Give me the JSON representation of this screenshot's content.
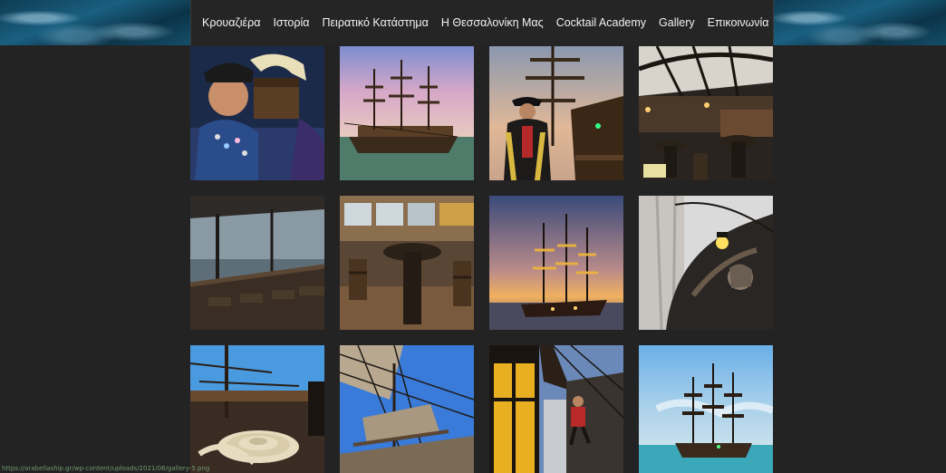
{
  "nav": {
    "items": [
      "Κρουαζιέρα",
      "Ιστορία",
      "Πειρατικό Κατάστημα",
      "Η Θεσσαλονίκη Μας",
      "Cocktail Academy",
      "Gallery",
      "Επικοινωνία"
    ],
    "flags": [
      "greek-flag-icon",
      "english-flag-icon"
    ]
  },
  "gallery": {
    "tiles": [
      {
        "name": "gallery-photo-pirate-with-chest"
      },
      {
        "name": "gallery-photo-ship-sunset-sea"
      },
      {
        "name": "gallery-photo-captain-on-deck"
      },
      {
        "name": "gallery-photo-deck-bar"
      },
      {
        "name": "gallery-photo-deck-railing"
      },
      {
        "name": "gallery-photo-barrel-tables"
      },
      {
        "name": "gallery-photo-ship-silhouette-sunset"
      },
      {
        "name": "gallery-photo-ship-figurehead"
      },
      {
        "name": "gallery-photo-rope-coils"
      },
      {
        "name": "gallery-photo-sails-rigging"
      },
      {
        "name": "gallery-photo-lantern-climber"
      },
      {
        "name": "gallery-photo-ship-turquoise-sea"
      }
    ]
  },
  "status": {
    "url": "https://arabellaship.gr/wp-content/uploads/2021/06/gallery-5.png"
  }
}
